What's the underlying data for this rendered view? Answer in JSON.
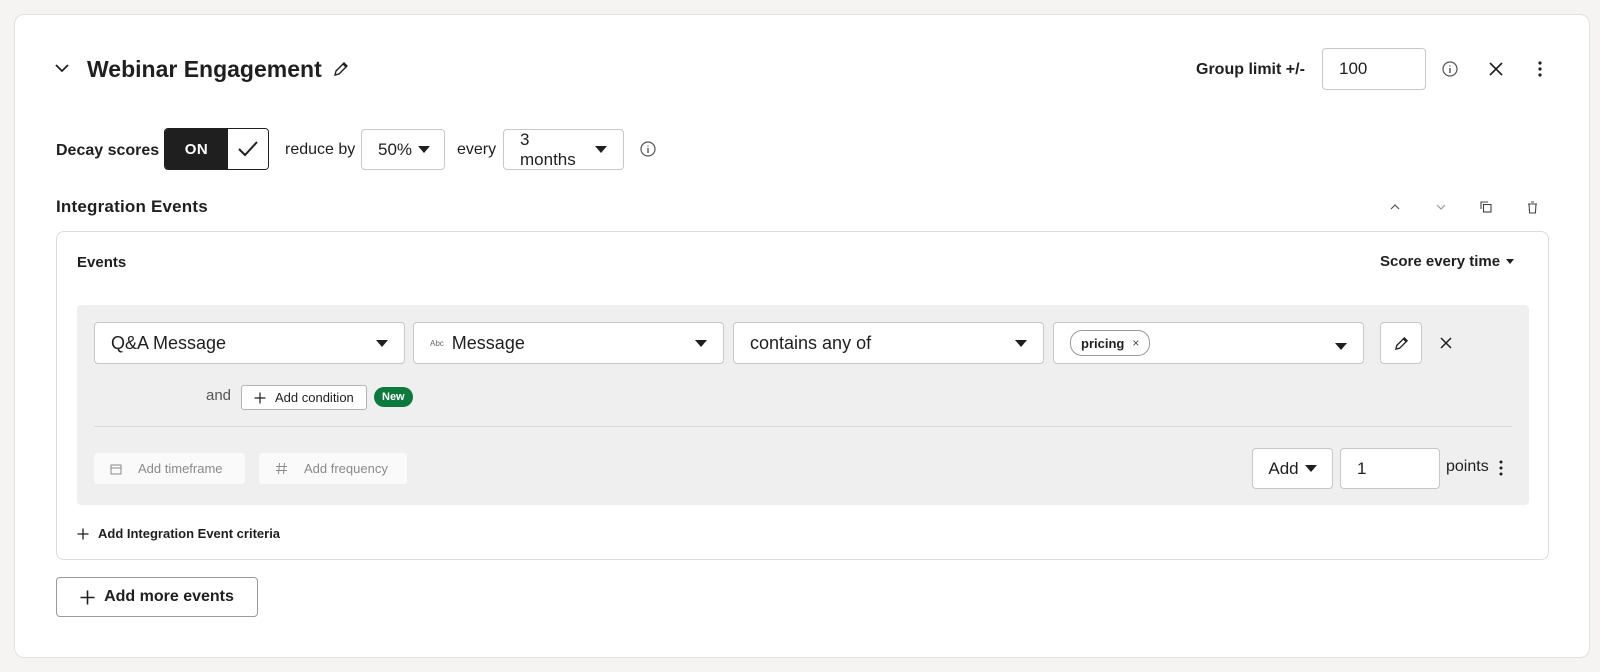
{
  "header": {
    "title": "Webinar Engagement",
    "group_limit_label": "Group limit +/-",
    "group_limit_value": "100"
  },
  "decay": {
    "label": "Decay scores",
    "toggle_label": "ON",
    "reduce_label": "reduce by",
    "reduce_value": "50%",
    "every_label": "every",
    "period_value": "3 months"
  },
  "section": {
    "title": "Integration Events",
    "events_label": "Events",
    "score_mode": "Score every time",
    "event_field": "Q&A Message",
    "property_type_icon": "Abc",
    "property_field": "Message",
    "operator_field": "contains any of",
    "value_chip": "pricing",
    "value_chip_remove": "×",
    "and_label": "and",
    "add_condition_label": "Add condition",
    "new_badge": "New",
    "add_timeframe_label": "Add timeframe",
    "add_frequency_label": "Add frequency",
    "score_action": "Add",
    "points_value": "1",
    "points_label": "points",
    "add_criteria_label": "Add Integration Event criteria"
  },
  "footer": {
    "add_more_label": "Add more events"
  },
  "colors": {
    "toggle_on_bg": "#1f1f1f",
    "new_badge_bg": "#0b7a3c",
    "panel_bg": "#efefef"
  }
}
